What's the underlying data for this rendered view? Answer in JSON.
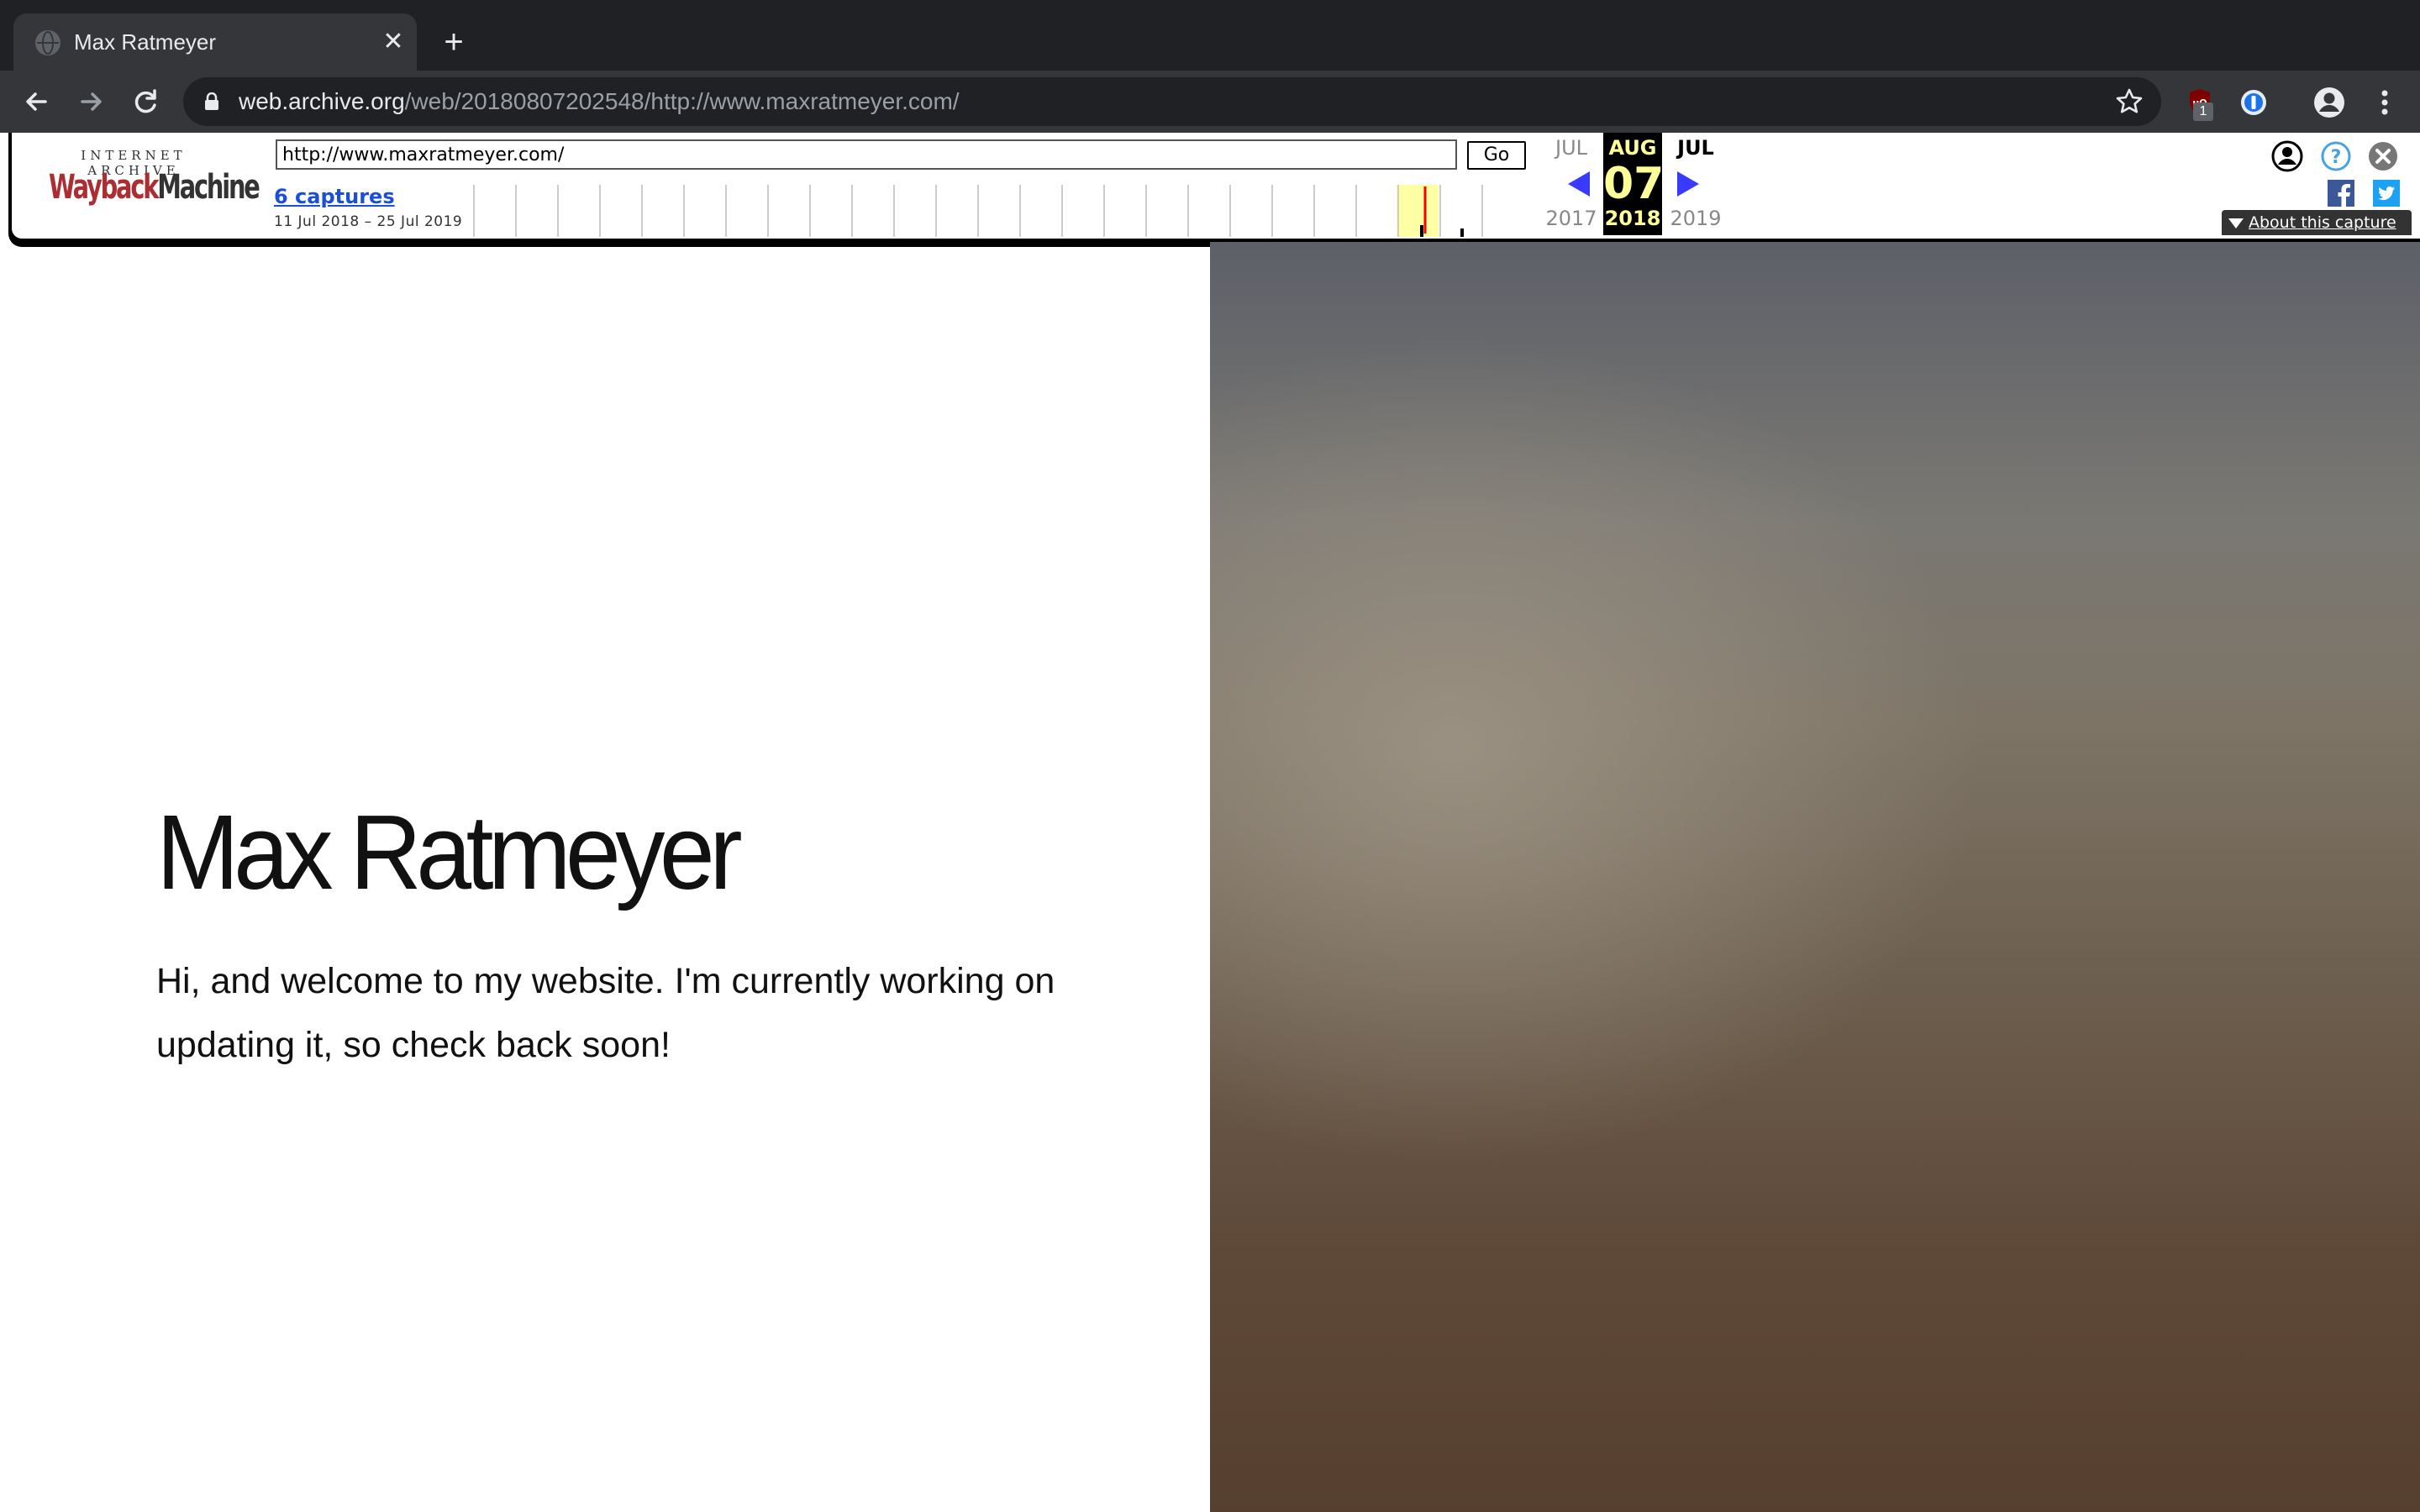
{
  "browser": {
    "tab_title": "Max Ratmeyer",
    "url_host": "web.archive.org",
    "url_path": "/web/20180807202548/http://www.maxratmeyer.com/",
    "extension_badge": "1"
  },
  "wayback": {
    "logo_top": "INTERNET ARCHIVE",
    "logo_wayback": "Wayback",
    "logo_machine": "Machine",
    "url_value": "http://www.maxratmeyer.com/",
    "go_label": "Go",
    "captures_label": "6 captures",
    "date_range": "11 Jul 2018 – 25 Jul 2019",
    "prev_month": "JUL",
    "current_month": "AUG",
    "next_month": "JUL",
    "current_day": "07",
    "prev_year": "2017",
    "current_year": "2018",
    "next_year": "2019",
    "about_label": "About this capture",
    "colors": {
      "current_highlight": "#ffff99",
      "arrow": "#3a3aff",
      "logo_red": "#ab2e33"
    }
  },
  "page": {
    "title": "Max Ratmeyer",
    "intro": "Hi, and welcome to my website. I'm currently working on updating it, so check back soon!"
  }
}
